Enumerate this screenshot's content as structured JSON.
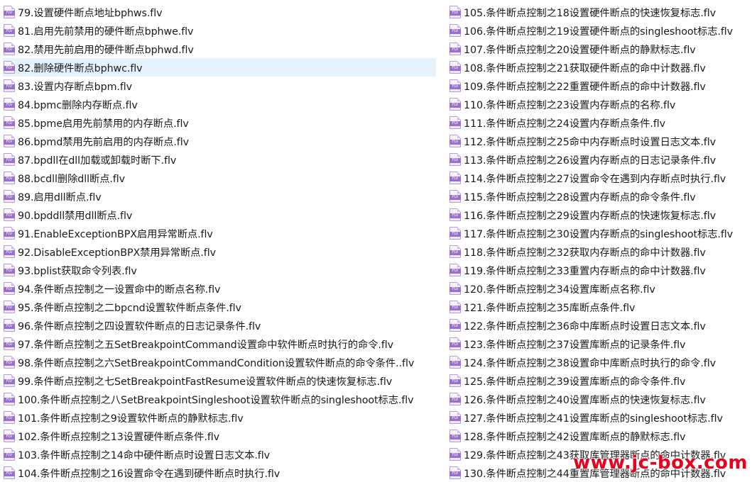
{
  "files_left": [
    {
      "name": "79.设置硬件断点地址bphws.flv",
      "selected": false
    },
    {
      "name": "81.启用先前禁用的硬件断点bphwe.flv",
      "selected": false
    },
    {
      "name": "82.禁用先前启用的硬件断点bphwd.flv",
      "selected": false
    },
    {
      "name": "82.删除硬件断点bphwc.flv",
      "selected": true
    },
    {
      "name": "83.设置内存断点bpm.flv",
      "selected": false
    },
    {
      "name": "84.bpmc删除内存断点.flv",
      "selected": false
    },
    {
      "name": "85.bpme启用先前禁用的内存断点.flv",
      "selected": false
    },
    {
      "name": "86.bpmd禁用先前启用的内存断点.flv",
      "selected": false
    },
    {
      "name": "87.bpdll在dll加载或卸载时断下.flv",
      "selected": false
    },
    {
      "name": "88.bcdll删除dll断点.flv",
      "selected": false
    },
    {
      "name": "89.启用dll断点.flv",
      "selected": false
    },
    {
      "name": "90.bpddll禁用dll断点.flv",
      "selected": false
    },
    {
      "name": "91.EnableExceptionBPX启用异常断点.flv",
      "selected": false
    },
    {
      "name": "92.DisableExceptionBPX禁用异常断点.flv",
      "selected": false
    },
    {
      "name": "93.bplist获取命令列表.flv",
      "selected": false
    },
    {
      "name": "94.条件断点控制之一设置命中的断点名称.flv",
      "selected": false
    },
    {
      "name": "95.条件断点控制之二bpcnd设置软件断点条件.flv",
      "selected": false
    },
    {
      "name": "96.条件断点控制之四设置软件断点的日志记录条件.flv",
      "selected": false
    },
    {
      "name": "97.条件断点控制之五SetBreakpointCommand设置命中软件断点时执行的命令.flv",
      "selected": false
    },
    {
      "name": "98.条件断点控制之六SetBreakpointCommandCondition设置软件断点的命令条件..flv",
      "selected": false
    },
    {
      "name": "99.条件断点控制之七SetBreakpointFastResume设置软件断点的快速恢复标志.flv",
      "selected": false
    },
    {
      "name": "100.条件断点控制之八SetBreakpointSingleshoot设置软件断点的singleshoot标志.flv",
      "selected": false
    },
    {
      "name": "101.条件断点控制之9设置软件断点的静默标志.flv",
      "selected": false
    },
    {
      "name": "102.条件断点控制之13设置硬件断点条件.flv",
      "selected": false
    },
    {
      "name": "103.条件断点控制之14命中硬件断点时设置日志文本.flv",
      "selected": false
    },
    {
      "name": "104.条件断点控制之16设置命令在遇到硬件断点时执行.flv",
      "selected": false
    }
  ],
  "files_right": [
    {
      "name": "105.条件断点控制之18设置硬件断点的快速恢复标志.flv",
      "selected": false
    },
    {
      "name": "106.条件断点控制之19设置硬件断点的singleshoot标志.flv",
      "selected": false
    },
    {
      "name": "107.条件断点控制之20设置硬件断点的静默标志.flv",
      "selected": false
    },
    {
      "name": "108.条件断点控制之21获取硬件断点的命中计数器.flv",
      "selected": false
    },
    {
      "name": "109.条件断点控制之22重置硬件断点的命中计数器.flv",
      "selected": false
    },
    {
      "name": "110.条件断点控制之23设置内存断点的名称.flv",
      "selected": false
    },
    {
      "name": "111.条件断点控制之24设置内存断点条件.flv",
      "selected": false
    },
    {
      "name": "112.条件断点控制之25命中内存断点时设置日志文本.flv",
      "selected": false
    },
    {
      "name": "113.条件断点控制之26设置内存断点的日志记录条件.flv",
      "selected": false
    },
    {
      "name": "114.条件断点控制之27设置命令在遇到内存断点时执行.flv",
      "selected": false
    },
    {
      "name": "115.条件断点控制之28设置内存断点的命令条件.flv",
      "selected": false
    },
    {
      "name": "116.条件断点控制之29设置内存断点的快速恢复标志.flv",
      "selected": false
    },
    {
      "name": "117.条件断点控制之30设置内存断点的singleshoot标志.flv",
      "selected": false
    },
    {
      "name": "118.条件断点控制之32获取内存断点的命中计数器.flv",
      "selected": false
    },
    {
      "name": "119.条件断点控制之33重置内存断点的命中计数器.flv",
      "selected": false
    },
    {
      "name": "120.条件断点控制之34设置库断点名称.flv",
      "selected": false
    },
    {
      "name": "121.条件断点控制之35库断点条件.flv",
      "selected": false
    },
    {
      "name": "122.条件断点控制之36命中库断点时设置日志文本.flv",
      "selected": false
    },
    {
      "name": "123.条件断点控制之37设置库断点的记录条件.flv",
      "selected": false
    },
    {
      "name": "124.条件断点控制之38设置命中库断点时执行的命令.flv",
      "selected": false
    },
    {
      "name": "125.条件断点控制之39设置库断点的命令条件.flv",
      "selected": false
    },
    {
      "name": "126.条件断点控制之40设置库断点的快速恢复标志.flv",
      "selected": false
    },
    {
      "name": "127.条件断点控制之41设置库断点的singleshoot标志.flv",
      "selected": false
    },
    {
      "name": "128.条件断点控制之42设置库断点的静默标志.flv",
      "selected": false
    },
    {
      "name": "129.条件断点控制之43获取库管理器断点的命中计数器.flv",
      "selected": false
    },
    {
      "name": "130.条件断点控制之44重置库管理器断点的命中计数器.flv",
      "selected": false
    }
  ],
  "file_icon": {
    "name": "flv-file-icon",
    "label": "FLV"
  },
  "colors": {
    "selection": "#e5f3ff",
    "icon_accent": "#9b6fcf",
    "watermark": "#e8001c"
  },
  "watermark": {
    "text": "www.jc-box.com"
  }
}
